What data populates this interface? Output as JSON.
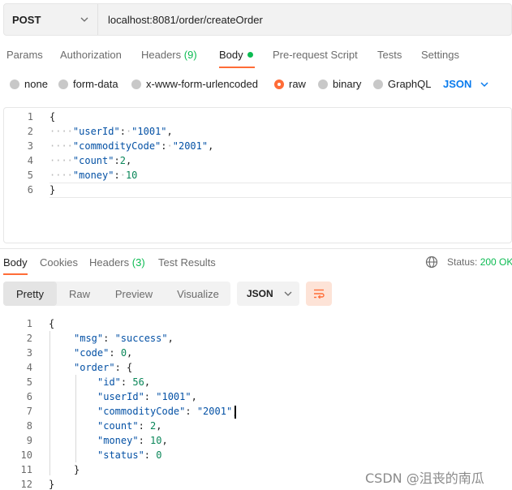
{
  "request": {
    "method": "POST",
    "url": "localhost:8081/order/createOrder",
    "tabs": [
      {
        "label": "Params"
      },
      {
        "label": "Authorization"
      },
      {
        "label": "Headers",
        "count": "(9)"
      },
      {
        "label": "Body"
      },
      {
        "label": "Pre-request Script"
      },
      {
        "label": "Tests"
      },
      {
        "label": "Settings"
      }
    ],
    "body_types": [
      "none",
      "form-data",
      "x-www-form-urlencoded",
      "raw",
      "binary",
      "GraphQL"
    ],
    "selected_body_type": "raw",
    "language": "JSON",
    "line_numbers": [
      "1",
      "2",
      "3",
      "4",
      "5",
      "6"
    ],
    "code": {
      "l1": "{",
      "l2_key": "\"userId\"",
      "l2_val": "\"1001\"",
      "l3_key": "\"commodityCode\"",
      "l3_val": "\"2001\"",
      "l4_key": "\"count\"",
      "l4_val": "2",
      "l5_key": "\"money\"",
      "l5_val": "10",
      "l6": "}"
    }
  },
  "response": {
    "tabs": [
      {
        "label": "Body"
      },
      {
        "label": "Cookies"
      },
      {
        "label": "Headers",
        "count": "(3)"
      },
      {
        "label": "Test Results"
      }
    ],
    "status_label": "Status:",
    "status_value": "200 OK",
    "views": [
      "Pretty",
      "Raw",
      "Preview",
      "Visualize"
    ],
    "active_view": "Pretty",
    "format": "JSON",
    "line_numbers": [
      "1",
      "2",
      "3",
      "4",
      "5",
      "6",
      "7",
      "8",
      "9",
      "10",
      "11",
      "12"
    ],
    "code": {
      "l1": "{",
      "msg_key": "\"msg\"",
      "msg_val": "\"success\"",
      "code_key": "\"code\"",
      "code_val": "0",
      "order_key": "\"order\"",
      "order_open": "{",
      "id_key": "\"id\"",
      "id_val": "56",
      "userId_key": "\"userId\"",
      "userId_val": "\"1001\"",
      "cc_key": "\"commodityCode\"",
      "cc_val": "\"2001\"",
      "count_key": "\"count\"",
      "count_val": "2",
      "money_key": "\"money\"",
      "money_val": "10",
      "status_key": "\"status\"",
      "status_val": "0",
      "order_close": "}",
      "l12": "}"
    }
  },
  "watermark": "CSDN @沮丧的南瓜",
  "colors": {
    "accent": "#ff6c37",
    "success": "#0cbb52",
    "link": "#097bed"
  }
}
